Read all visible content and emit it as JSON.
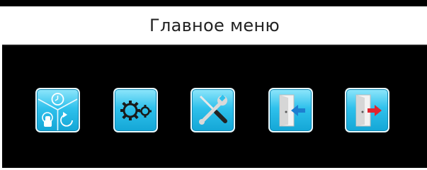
{
  "header": {
    "title": "Главное меню"
  },
  "menu": {
    "items": [
      {
        "icon": "clock-modes-icon",
        "name": "modes"
      },
      {
        "icon": "gears-icon",
        "name": "settings"
      },
      {
        "icon": "tools-icon",
        "name": "service"
      },
      {
        "icon": "door-enter-icon",
        "name": "login"
      },
      {
        "icon": "door-exit-icon",
        "name": "logout"
      }
    ]
  },
  "colors": {
    "background": "#000000",
    "tile_light": "#8fe6fb",
    "tile_dark": "#14a6d6",
    "login_arrow": "#1d7fd0",
    "logout_arrow": "#e0242e"
  }
}
